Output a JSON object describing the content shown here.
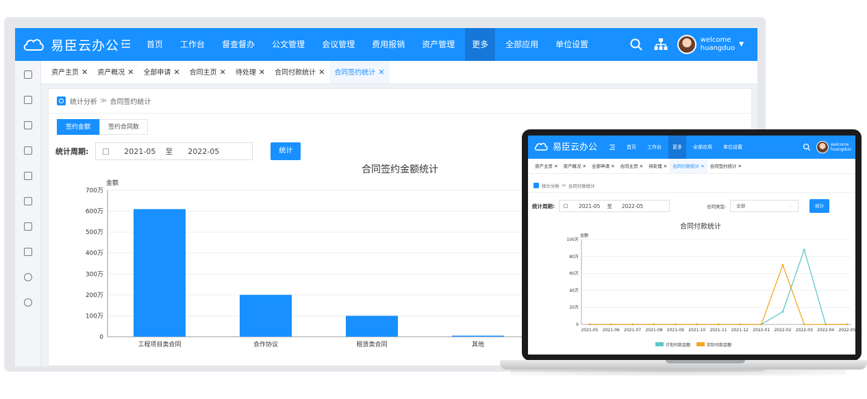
{
  "app": {
    "name": "易臣云办公",
    "welcome": "welcome",
    "username": "huangduo"
  },
  "colors": {
    "brand": "#1890ff",
    "series_plan": "#5ec8c8",
    "series_actual": "#f4a623"
  },
  "nav": [
    "首页",
    "工作台",
    "督查督办",
    "公文管理",
    "会议管理",
    "费用报销",
    "资产管理",
    "更多",
    "全部应用",
    "单位设置"
  ],
  "nav_active_index": 7,
  "sidebar_icons": [
    "document-icon",
    "report-icon",
    "form-icon",
    "note-icon",
    "calculator-icon",
    "grid-icon",
    "people-icon",
    "archive-icon",
    "clock-icon",
    "copyright-icon"
  ],
  "tabs": [
    {
      "label": "资产主页",
      "active": false
    },
    {
      "label": "资产概况",
      "active": false
    },
    {
      "label": "全部申请",
      "active": false
    },
    {
      "label": "合同主页",
      "active": false
    },
    {
      "label": "待处理",
      "active": false
    },
    {
      "label": "合同付款统计",
      "active": false
    },
    {
      "label": "合同签约统计",
      "active": true
    }
  ],
  "breadcrumb": {
    "root": "统计分析",
    "sep": "≫",
    "current": "合同签约统计"
  },
  "subtabs": [
    {
      "label": "签约金额",
      "active": true
    },
    {
      "label": "签约合同数",
      "active": false
    }
  ],
  "filter": {
    "label": "统计周期:",
    "from": "2021-05",
    "to_label": "至",
    "to": "2022-05",
    "button": "统计"
  },
  "chart_data": [
    {
      "type": "bar",
      "title": "合同签约金额统计",
      "ylabel": "金额",
      "categories": [
        "工程项目类合同",
        "合作协议",
        "租赁类合同",
        "其他"
      ],
      "values": [
        610,
        200,
        100,
        5
      ],
      "ylim": [
        0,
        700
      ],
      "yticks": [
        "0",
        "100万",
        "200万",
        "300万",
        "400万",
        "500万",
        "600万",
        "700万"
      ],
      "grid": true
    },
    {
      "type": "line",
      "title": "合同付款统计",
      "ylabel": "金额",
      "x": [
        "2021-05",
        "2021-06",
        "2021-07",
        "2021-08",
        "2021-09",
        "2021-10",
        "2021-11",
        "2021-12",
        "2022-01",
        "2022-02",
        "2022-03",
        "2022-04",
        "2022-05"
      ],
      "series": [
        {
          "name": "计划付款金额",
          "values": [
            0,
            0,
            0,
            0,
            0,
            0,
            0,
            0,
            0,
            15,
            88,
            0,
            0
          ]
        },
        {
          "name": "实际付款金额",
          "values": [
            0,
            0,
            0,
            0,
            0,
            0,
            0,
            0,
            0,
            70,
            0,
            0,
            0
          ]
        }
      ],
      "ylim": [
        0,
        100
      ],
      "yticks": [
        "0",
        "20万",
        "40万",
        "60万",
        "80万",
        "100万"
      ],
      "legend": "bottom",
      "grid": true
    }
  ],
  "laptop": {
    "nav": [
      "首页",
      "工作台",
      "更多",
      "全部应用",
      "单位设置"
    ],
    "nav_active_index": 2,
    "tabs": [
      {
        "label": "资产主页",
        "active": false
      },
      {
        "label": "资产概况",
        "active": false
      },
      {
        "label": "全部申请",
        "active": false
      },
      {
        "label": "合同主页",
        "active": false
      },
      {
        "label": "待处理",
        "active": false
      },
      {
        "label": "合同付款统计",
        "active": true
      },
      {
        "label": "合同签约统计",
        "active": false
      }
    ],
    "breadcrumb": {
      "root": "统计分析",
      "sep": "≫",
      "current": "合同付款统计"
    },
    "filter": {
      "label": "统计周期:",
      "from": "2021-05",
      "to_label": "至",
      "to": "2022-05",
      "type_label": "合同类型:",
      "type_value": "全部",
      "button": "统计"
    }
  }
}
